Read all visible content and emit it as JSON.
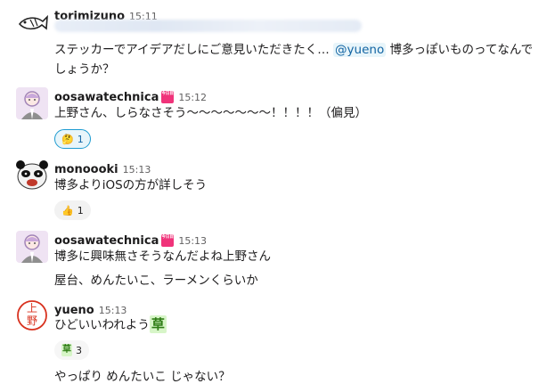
{
  "messages": [
    {
      "user": "torimizuno",
      "time": "15:11",
      "text": "ステッカーでアイデアだしにご意見いただきたく…",
      "mention": "@yueno",
      "text_after": " 博多っぽいものってなんでしょうか？"
    },
    {
      "user": "oosawatechnica",
      "badge": "今日目標",
      "time": "15:12",
      "text": "上野さん、しらなさそう〜〜〜〜〜〜〜！！！！（偏見）",
      "reaction": {
        "emoji": "🤔",
        "count": "1"
      }
    },
    {
      "user": "monoooki",
      "time": "15:13",
      "text": "博多よりiOSの方が詳しそう",
      "reaction": {
        "emoji": "👍",
        "count": "1"
      }
    },
    {
      "user": "oosawatechnica",
      "badge": "今日目標",
      "time": "15:13",
      "text": "博多に興味無さそうなんだよね上野さん",
      "followup": "屋台、めんたいこ、ラーメンくらいか"
    },
    {
      "user": "yueno",
      "time": "15:13",
      "avatar_text": "上野",
      "text": "ひどいいわれよう",
      "inline_emoji": "草",
      "reaction": {
        "emoji": "草",
        "count": "3"
      },
      "followup": "やっぱり めんたいこ じゃない？"
    }
  ],
  "colors": {
    "link": "#1264a3",
    "mention_bg": "#e8f5fa",
    "reaction_active_border": "#1d9bd1",
    "badge": "#f0337a",
    "hanko_red": "#d8321f",
    "kusa_bg": "#d7f5c8"
  }
}
